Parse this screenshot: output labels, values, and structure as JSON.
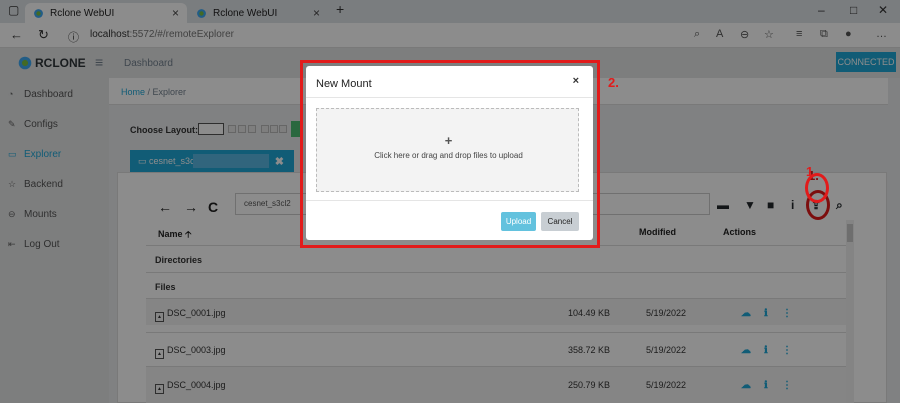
{
  "browser": {
    "tabs": [
      {
        "label": "Rclone WebUI"
      },
      {
        "label": "Rclone WebUI"
      }
    ],
    "new_tab": "+",
    "url_host": "localhost",
    "url_rest": ":5572/#/remoteExplorer"
  },
  "app": {
    "brand": "RCLONE",
    "header_link": "Dashboard",
    "status": "CONNECTED",
    "sidebar": [
      {
        "label": "Dashboard",
        "icon": "speedometer-icon"
      },
      {
        "label": "Configs",
        "icon": "edit-icon"
      },
      {
        "label": "Explorer",
        "icon": "monitor-icon"
      },
      {
        "label": "Backend",
        "icon": "star-icon"
      },
      {
        "label": "Mounts",
        "icon": "drive-icon"
      },
      {
        "label": "Log Out",
        "icon": "logout-icon"
      }
    ],
    "breadcrumb": {
      "home": "Home",
      "sep": " / ",
      "current": "Explorer"
    },
    "choose_layout": "Choose Layout:",
    "remote_tab": "cesnet_s3cl2",
    "path": "cesnet_s3cl2",
    "table": {
      "headers": {
        "name": "Name",
        "modified": "Modified",
        "actions": "Actions"
      },
      "directories_label": "Directories",
      "files_label": "Files",
      "rows": [
        {
          "name": "DSC_0001.jpg",
          "size": "104.49 KB",
          "modified": "5/19/2022"
        },
        {
          "name": "DSC_0003.jpg",
          "size": "358.72 KB",
          "modified": "5/19/2022"
        },
        {
          "name": "DSC_0004.jpg",
          "size": "250.79 KB",
          "modified": "5/19/2022"
        }
      ]
    }
  },
  "annotations": {
    "one": "1.",
    "two": "2."
  },
  "modal": {
    "title": "New Mount",
    "close": "×",
    "drop_plus": "+",
    "drop_text": "Click here or drag and drop files to upload",
    "upload": "Upload",
    "cancel": "Cancel"
  },
  "colors": {
    "accent": "#20a8d8",
    "highlight": "#e21b1b",
    "success": "#4dbd74"
  }
}
